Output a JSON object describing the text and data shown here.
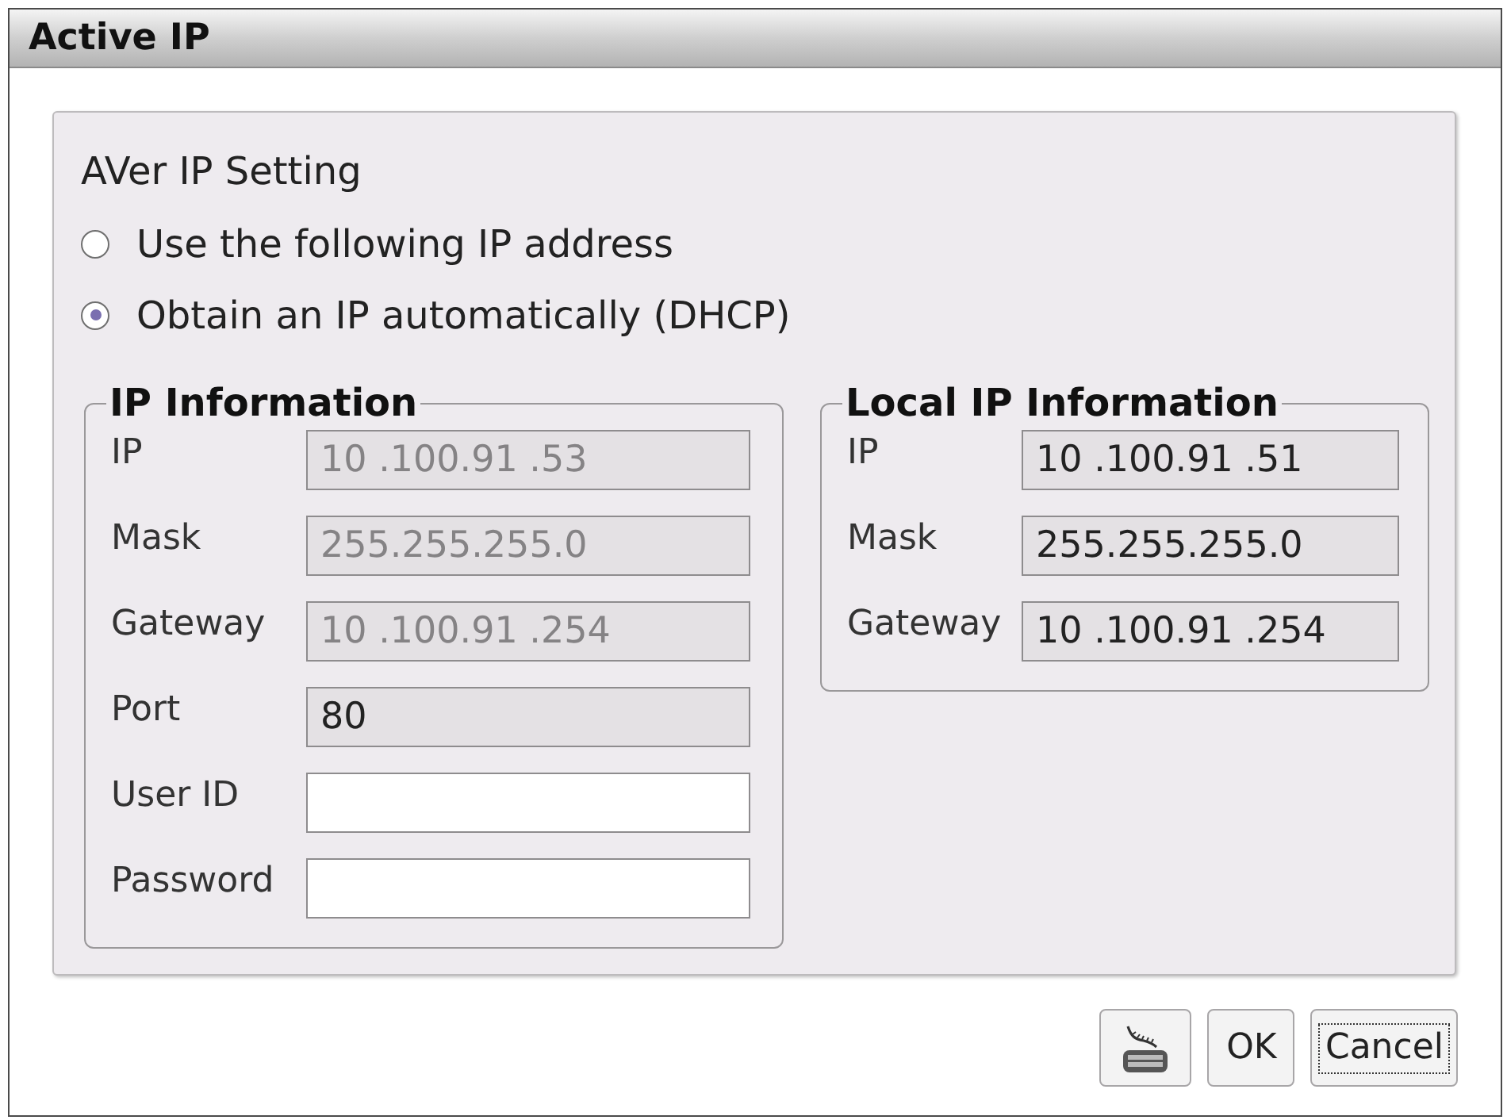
{
  "window": {
    "title": "Active IP"
  },
  "setting": {
    "title": "AVer IP Setting",
    "options": [
      {
        "label": "Use the following IP address",
        "selected": false
      },
      {
        "label": "Obtain an IP automatically (DHCP)",
        "selected": true
      }
    ]
  },
  "ip_information": {
    "title": "IP Information",
    "fields": [
      {
        "label": "IP",
        "value": "10 .100.91 .53",
        "disabled": true,
        "editable": false
      },
      {
        "label": "Mask",
        "value": "255.255.255.0",
        "disabled": true,
        "editable": false
      },
      {
        "label": "Gateway",
        "value": "10 .100.91 .254",
        "disabled": true,
        "editable": false
      },
      {
        "label": "Port",
        "value": "80",
        "disabled": false,
        "editable": false
      },
      {
        "label": "User ID",
        "disabled": false,
        "editable": true
      },
      {
        "label": "Password",
        "disabled": false,
        "editable": true
      }
    ]
  },
  "local_ip_information": {
    "title": "Local IP Information",
    "fields": [
      {
        "label": "IP",
        "value": "10 .100.91 .51",
        "disabled": false,
        "editable": false
      },
      {
        "label": "Mask",
        "value": "255.255.255.0",
        "disabled": false,
        "editable": false
      },
      {
        "label": "Gateway",
        "value": "10 .100.91 .254",
        "disabled": false,
        "editable": false
      }
    ]
  },
  "buttons": [
    {
      "kind": "keyboard",
      "focused": false
    },
    {
      "kind": "text",
      "label": "OK",
      "focused": false
    },
    {
      "kind": "text",
      "label": "Cancel",
      "focused": true
    }
  ]
}
